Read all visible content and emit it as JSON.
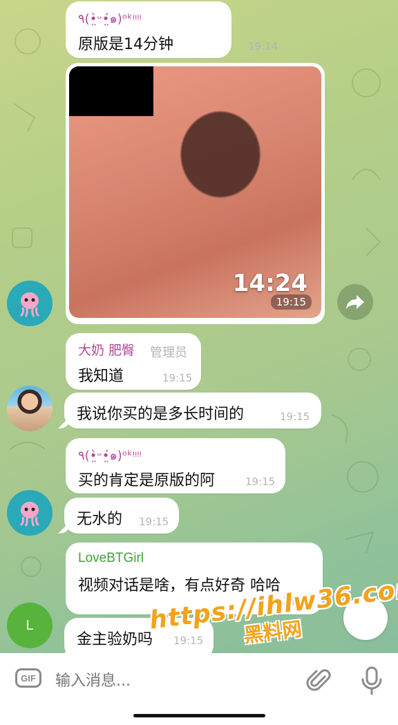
{
  "messages": [
    {
      "sender": "٩(•̤̀ᵕ•̤́๑)ᵒᵏᵎᵎᵎᵎ",
      "text": "原版是14分钟",
      "time": "19:14"
    },
    {
      "media": {
        "duration": "14:24",
        "time": "19:15"
      }
    },
    {
      "sender": "大奶 肥臀",
      "role": "管理员",
      "text": "我知道",
      "time": "19:15"
    },
    {
      "text": "我说你买的是多长时间的",
      "time": "19:15"
    },
    {
      "sender": "٩(•̤̀ᵕ•̤́๑)ᵒᵏᵎᵎᵎᵎ",
      "text": "买的肯定是原版的阿",
      "time": "19:15"
    },
    {
      "text": "无水的",
      "time": "19:15"
    },
    {
      "sender": "LoveBTGirl",
      "text": "视频对话是啥，有点好奇 哈哈",
      "time": "19:15"
    },
    {
      "text": "金主验奶吗",
      "time": "19:15"
    }
  ],
  "avatars": {
    "letter": "L"
  },
  "input": {
    "placeholder": "输入消息..."
  },
  "watermark": {
    "url": "https://ihlw36.com",
    "name": "黑料网"
  },
  "colors": {
    "sender_pink": "#b04a9c",
    "sender_green": "#3aa43a",
    "time_gray": "#b5b5b5",
    "watermark_orange": "#f3a21b"
  }
}
